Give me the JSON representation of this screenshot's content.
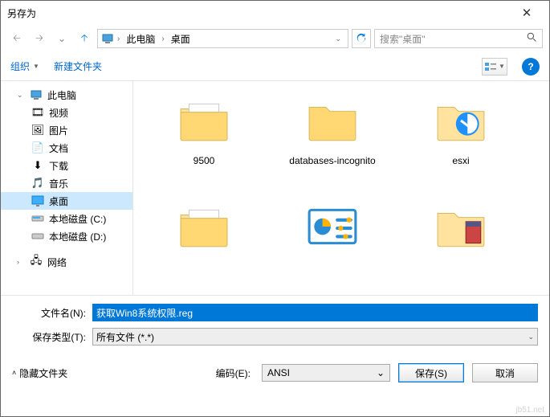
{
  "title": "另存为",
  "breadcrumb": {
    "seg1": "此电脑",
    "seg2": "桌面"
  },
  "search": {
    "placeholder": "搜索\"桌面\""
  },
  "toolbar": {
    "organize": "组织",
    "newfolder": "新建文件夹"
  },
  "tree": {
    "root": "此电脑",
    "items": [
      {
        "label": "视频"
      },
      {
        "label": "图片"
      },
      {
        "label": "文档"
      },
      {
        "label": "下载"
      },
      {
        "label": "音乐"
      },
      {
        "label": "桌面",
        "selected": true
      },
      {
        "label": "本地磁盘 (C:)"
      },
      {
        "label": "本地磁盘 (D:)"
      }
    ],
    "network": "网络"
  },
  "files": [
    {
      "name": "9500",
      "type": "folder"
    },
    {
      "name": "databases-incognito",
      "type": "folder"
    },
    {
      "name": "esxi",
      "type": "app-blue"
    },
    {
      "name": "",
      "type": "folder"
    },
    {
      "name": "",
      "type": "app-chart"
    },
    {
      "name": "",
      "type": "folder-archive"
    }
  ],
  "form": {
    "filename_label": "文件名(N):",
    "filename_value": "获取Win8系统权限.reg",
    "savetype_label": "保存类型(T):",
    "savetype_value": "所有文件 (*.*)"
  },
  "footer": {
    "hide_folders": "隐藏文件夹",
    "encoding_label": "编码(E):",
    "encoding_value": "ANSI",
    "save": "保存(S)",
    "cancel": "取消"
  }
}
